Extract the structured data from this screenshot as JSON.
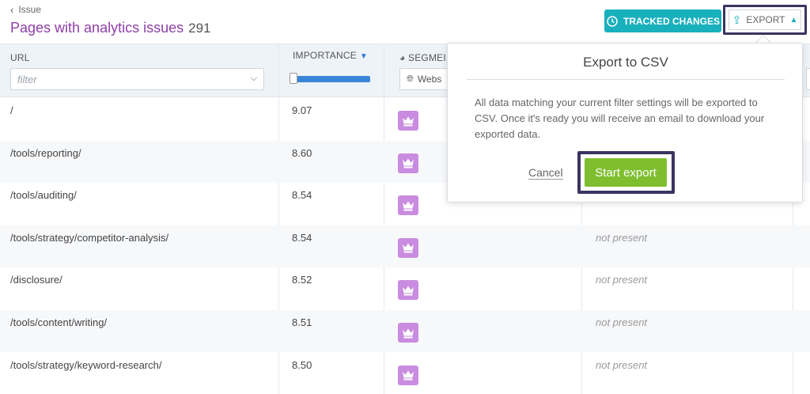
{
  "header": {
    "back_label": "Issue",
    "title": "Pages with analytics issues",
    "count": "291",
    "tracked_changes_label": "TRACKED CHANGES",
    "export_label": "EXPORT"
  },
  "table": {
    "columns": {
      "url": "URL",
      "importance": "IMPORTANCE",
      "segment": "SEGMEI"
    },
    "url_filter_placeholder": "filter",
    "segment_value": "Webs",
    "importance_slider_fraction": 1.0,
    "rows": [
      {
        "url": "/",
        "importance": "9.07",
        "status": ""
      },
      {
        "url": "/tools/reporting/",
        "importance": "8.60",
        "status": ""
      },
      {
        "url": "/tools/auditing/",
        "importance": "8.54",
        "status": ""
      },
      {
        "url": "/tools/strategy/competitor-analysis/",
        "importance": "8.54",
        "status": "not present"
      },
      {
        "url": "/disclosure/",
        "importance": "8.52",
        "status": "not present"
      },
      {
        "url": "/tools/content/writing/",
        "importance": "8.51",
        "status": "not present"
      },
      {
        "url": "/tools/strategy/keyword-research/",
        "importance": "8.50",
        "status": "not present"
      }
    ]
  },
  "popup": {
    "title": "Export to CSV",
    "body": "All data matching your current filter settings will be exported to CSV. Once it's ready you will receive an email to download your exported data.",
    "cancel_label": "Cancel",
    "start_label": "Start export"
  },
  "colors": {
    "title_purple": "#8e3fa8",
    "teal": "#19b0bd",
    "green": "#7fbf2f",
    "highlight": "#3a3560",
    "crown": "#c98ce0"
  },
  "icons": {
    "back": "chevron-left-icon",
    "tracked": "history-icon",
    "export": "upload-icon",
    "export_caret": "chevron-up-icon",
    "filter_dropdown": "chevron-down-icon",
    "segment": "globe-icon",
    "row_badge": "crown-icon",
    "segment_header": "pie-chart-icon"
  }
}
